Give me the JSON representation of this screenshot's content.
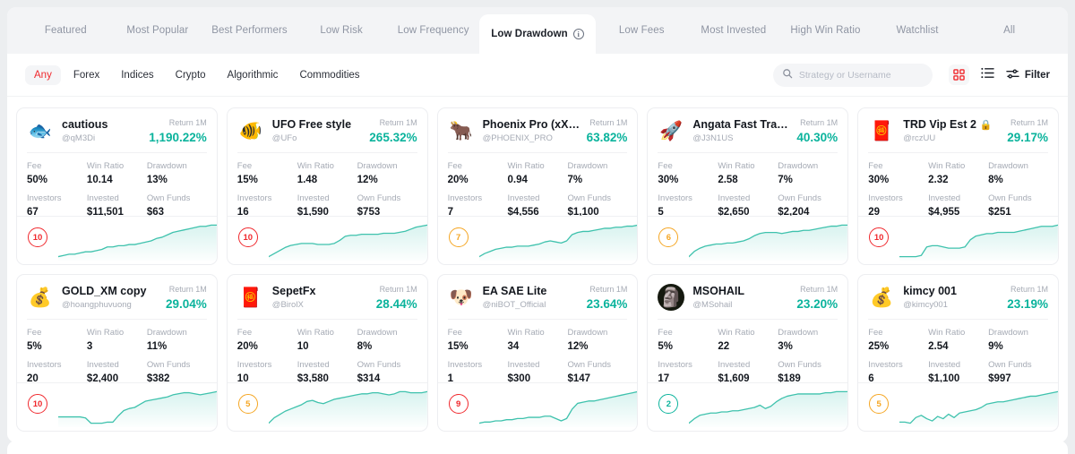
{
  "theme": {
    "accent_red": "#f0282d",
    "accent_teal": "#0ab39c",
    "accent_yellow": "#f5a623",
    "page_bg": "#eceef0",
    "panel_bg": "#ffffff",
    "tabstrip_bg": "#f3f4f6",
    "muted_text": "#a6abb5"
  },
  "tabs": [
    {
      "label": "Featured",
      "active": false,
      "info": false
    },
    {
      "label": "Most Popular",
      "active": false,
      "info": false
    },
    {
      "label": "Best Performers",
      "active": false,
      "info": false
    },
    {
      "label": "Low Risk",
      "active": false,
      "info": false
    },
    {
      "label": "Low Frequency",
      "active": false,
      "info": false
    },
    {
      "label": "Low Drawdown",
      "active": true,
      "info": true
    },
    {
      "label": "Low Fees",
      "active": false,
      "info": false
    },
    {
      "label": "Most Invested",
      "active": false,
      "info": false
    },
    {
      "label": "High Win Ratio",
      "active": false,
      "info": false
    },
    {
      "label": "Watchlist",
      "active": false,
      "info": false
    },
    {
      "label": "All",
      "active": false,
      "info": false
    }
  ],
  "info_icon_glyph": "i",
  "filters": {
    "chips": [
      {
        "label": "Any",
        "active": true
      },
      {
        "label": "Forex",
        "active": false
      },
      {
        "label": "Indices",
        "active": false
      },
      {
        "label": "Crypto",
        "active": false
      },
      {
        "label": "Algorithmic",
        "active": false
      },
      {
        "label": "Commodities",
        "active": false
      }
    ],
    "search": {
      "value": "",
      "placeholder": "Strategy or Username",
      "icon": "search-icon"
    },
    "grid_view_icon": "grid-view-icon",
    "list_view_icon": "list-view-icon",
    "filter_label": "Filter",
    "filter_icon": "sliders-icon"
  },
  "card_labels": {
    "return": "Return 1M",
    "fee": "Fee",
    "win_ratio": "Win Ratio",
    "drawdown": "Drawdown",
    "investors": "Investors",
    "invested": "Invested",
    "own_funds": "Own Funds"
  },
  "cards": [
    {
      "name": "cautious",
      "username": "@qM3Di",
      "avatar": "🐟",
      "avatar_dark": false,
      "locked": false,
      "return": "1,190.22%",
      "fee": "50%",
      "win_ratio": "10.14",
      "drawdown": "13%",
      "investors": "67",
      "invested": "$11,501",
      "own_funds": "$63",
      "badge": "10",
      "badge_color": "red",
      "spark": [
        30,
        29,
        28,
        28,
        27,
        26,
        26,
        25,
        24,
        22,
        22,
        21,
        21,
        20,
        20,
        19,
        18,
        17,
        15,
        14,
        12,
        10,
        9,
        8,
        7,
        6,
        5,
        5,
        4,
        4
      ]
    },
    {
      "name": "UFO Free style",
      "username": "@UFo",
      "avatar": "🐠",
      "avatar_dark": false,
      "locked": false,
      "return": "265.32%",
      "fee": "15%",
      "win_ratio": "1.48",
      "drawdown": "12%",
      "investors": "16",
      "invested": "$1,590",
      "own_funds": "$753",
      "badge": "10",
      "badge_color": "red",
      "spark": [
        34,
        31,
        28,
        25,
        23,
        22,
        21,
        21,
        21,
        22,
        22,
        22,
        21,
        18,
        14,
        13,
        13,
        12,
        12,
        12,
        12,
        11,
        11,
        11,
        10,
        9,
        7,
        5,
        4,
        3
      ]
    },
    {
      "name": "Phoenix Pro (xX…",
      "username": "@PHOENIX_PRO",
      "avatar": "🐂",
      "avatar_dark": false,
      "locked": false,
      "return": "63.82%",
      "fee": "20%",
      "win_ratio": "0.94",
      "drawdown": "7%",
      "investors": "7",
      "invested": "$4,556",
      "own_funds": "$1,100",
      "badge": "7",
      "badge_color": "yellow",
      "spark": [
        34,
        31,
        29,
        27,
        26,
        25,
        25,
        24,
        24,
        24,
        23,
        22,
        20,
        19,
        20,
        21,
        19,
        13,
        11,
        10,
        10,
        9,
        8,
        7,
        7,
        6,
        6,
        5,
        5,
        4
      ]
    },
    {
      "name": "Angata Fast Tra…",
      "username": "@J3N1US",
      "avatar": "🚀",
      "avatar_dark": false,
      "locked": false,
      "return": "40.30%",
      "fee": "30%",
      "win_ratio": "2.58",
      "drawdown": "7%",
      "investors": "5",
      "invested": "$2,650",
      "own_funds": "$2,204",
      "badge": "6",
      "badge_color": "yellow",
      "spark": [
        34,
        29,
        26,
        24,
        23,
        22,
        22,
        21,
        21,
        20,
        19,
        17,
        14,
        12,
        11,
        11,
        11,
        12,
        11,
        10,
        10,
        9,
        9,
        8,
        7,
        6,
        5,
        5,
        4,
        4
      ]
    },
    {
      "name": "TRD Vip Est 2",
      "username": "@rczUU",
      "avatar": "🧧",
      "avatar_dark": false,
      "locked": true,
      "return": "29.17%",
      "fee": "30%",
      "win_ratio": "2.32",
      "drawdown": "8%",
      "investors": "29",
      "invested": "$4,955",
      "own_funds": "$251",
      "badge": "10",
      "badge_color": "red",
      "spark": [
        30,
        30,
        30,
        30,
        29,
        22,
        21,
        21,
        22,
        23,
        23,
        23,
        22,
        16,
        13,
        12,
        11,
        11,
        10,
        10,
        10,
        10,
        9,
        8,
        7,
        6,
        5,
        5,
        5,
        4
      ]
    },
    {
      "name": "GOLD_XM copy",
      "username": "@hoangphuvuong",
      "avatar": "💰",
      "avatar_dark": false,
      "locked": false,
      "return": "29.04%",
      "fee": "5%",
      "win_ratio": "3",
      "drawdown": "11%",
      "investors": "20",
      "invested": "$2,400",
      "own_funds": "$382",
      "badge": "10",
      "badge_color": "red",
      "spark": [
        28,
        28,
        28,
        28,
        28,
        29,
        34,
        34,
        34,
        33,
        33,
        27,
        22,
        20,
        19,
        16,
        13,
        12,
        11,
        10,
        9,
        7,
        6,
        5,
        5,
        6,
        7,
        6,
        5,
        4
      ]
    },
    {
      "name": "SepetFx",
      "username": "@BirolX",
      "avatar": "🧧",
      "avatar_dark": false,
      "locked": false,
      "return": "28.44%",
      "fee": "20%",
      "win_ratio": "10",
      "drawdown": "8%",
      "investors": "10",
      "invested": "$3,580",
      "own_funds": "$314",
      "badge": "5",
      "badge_color": "yellow",
      "spark": [
        34,
        29,
        26,
        23,
        21,
        19,
        17,
        14,
        13,
        15,
        16,
        14,
        12,
        11,
        10,
        9,
        8,
        7,
        7,
        6,
        6,
        7,
        8,
        7,
        5,
        5,
        6,
        6,
        6,
        5
      ]
    },
    {
      "name": "EA SAE Lite",
      "username": "@niBOT_Official",
      "avatar": "🐶",
      "avatar_dark": false,
      "locked": false,
      "return": "23.64%",
      "fee": "15%",
      "win_ratio": "34",
      "drawdown": "12%",
      "investors": "1",
      "invested": "$300",
      "own_funds": "$147",
      "badge": "9",
      "badge_color": "red",
      "spark": [
        30,
        29,
        29,
        28,
        28,
        27,
        27,
        26,
        26,
        25,
        25,
        25,
        24,
        24,
        26,
        28,
        26,
        18,
        13,
        12,
        11,
        11,
        10,
        9,
        8,
        7,
        6,
        5,
        4,
        3
      ]
    },
    {
      "name": "MSOHAIL",
      "username": "@MSohail",
      "avatar": "🗿",
      "avatar_dark": true,
      "locked": false,
      "return": "23.20%",
      "fee": "5%",
      "win_ratio": "22",
      "drawdown": "3%",
      "investors": "17",
      "invested": "$1,609",
      "own_funds": "$189",
      "badge": "2",
      "badge_color": "teal",
      "spark": [
        33,
        29,
        26,
        25,
        24,
        24,
        23,
        23,
        22,
        22,
        21,
        20,
        19,
        17,
        20,
        18,
        14,
        11,
        9,
        8,
        7,
        7,
        7,
        7,
        7,
        6,
        6,
        5,
        5,
        5
      ]
    },
    {
      "name": "kimcy 001",
      "username": "@kimcy001",
      "avatar": "💰",
      "avatar_dark": false,
      "locked": false,
      "return": "23.19%",
      "fee": "25%",
      "win_ratio": "2.54",
      "drawdown": "9%",
      "investors": "6",
      "invested": "$1,100",
      "own_funds": "$997",
      "badge": "5",
      "badge_color": "yellow",
      "spark": [
        30,
        30,
        31,
        26,
        24,
        27,
        29,
        25,
        27,
        23,
        26,
        22,
        21,
        20,
        19,
        17,
        14,
        13,
        12,
        12,
        11,
        10,
        9,
        8,
        7,
        7,
        6,
        5,
        4,
        3
      ]
    }
  ]
}
